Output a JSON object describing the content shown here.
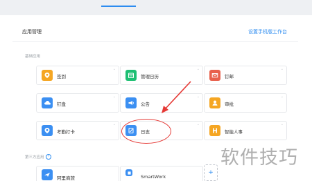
{
  "header": {
    "title": "应用管理",
    "link": "设置手机版工作台"
  },
  "sections": {
    "basic": "基础应用",
    "third": "第三方应用"
  },
  "basic_apps": [
    {
      "label": "签到",
      "icon": "location-pin-icon",
      "color": "#f5a623"
    },
    {
      "label": "管理日历",
      "icon": "calendar-icon",
      "color": "#1dbf73"
    },
    {
      "label": "钉邮",
      "icon": "mail-icon",
      "color": "#e8604c"
    },
    {
      "label": "钉盘",
      "icon": "cloud-icon",
      "color": "#3b8ff2"
    },
    {
      "label": "公告",
      "icon": "megaphone-icon",
      "color": "#3b8ff2"
    },
    {
      "label": "审批",
      "icon": "user-icon",
      "color": "#f5a623"
    },
    {
      "label": "考勤打卡",
      "icon": "location-pin-icon",
      "color": "#3b8ff2"
    },
    {
      "label": "日志",
      "icon": "notebook-icon",
      "color": "#3b8ff2"
    },
    {
      "label": "智能人事",
      "icon": "h-logo-icon",
      "color": "#f5a623"
    }
  ],
  "third_apps": [
    {
      "label": "阿里商旅",
      "icon": "plane-icon",
      "color": "#3b8ff2"
    },
    {
      "label": "SmartWork",
      "icon": "smartwork-icon",
      "color": "#3b8ff2"
    }
  ],
  "add_label": "+",
  "watermark": "软件技巧",
  "chevron": "⌄"
}
